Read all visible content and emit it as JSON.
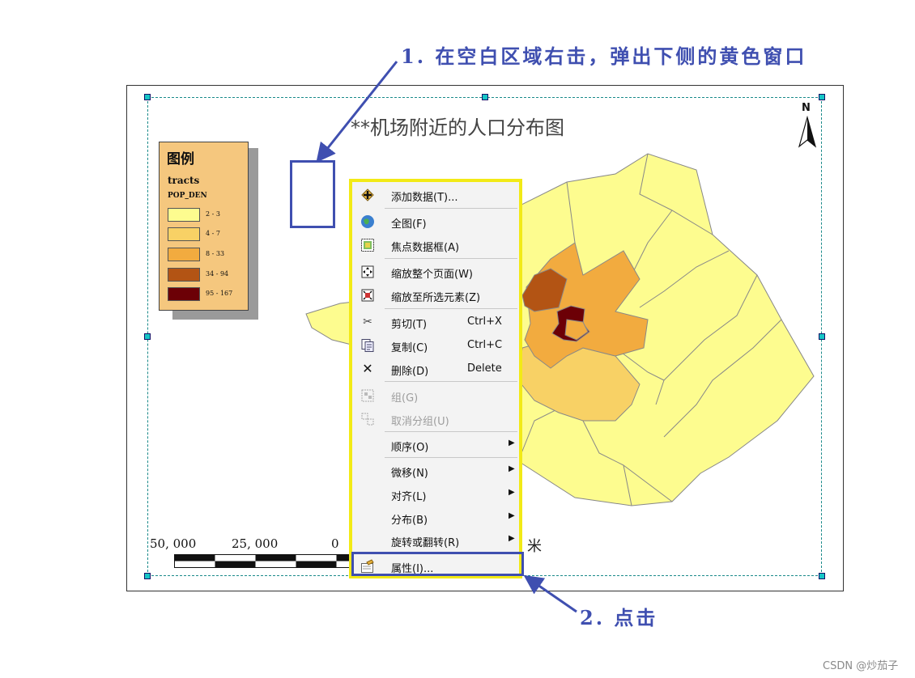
{
  "annotations": {
    "step1": "1. 在空白区域右击，弹出下侧的黄色窗口",
    "step2": "2. 点击"
  },
  "map": {
    "title": "**机场附近的人口分布图",
    "north_label": "N",
    "scale_labels": [
      "50, 000",
      "25, 000",
      "0"
    ],
    "scale_unit": "米"
  },
  "legend": {
    "title": "图例",
    "layer": "tracts",
    "field": "POP_DEN",
    "classes": [
      {
        "label": "2 - 3",
        "color": "#fdfc8f"
      },
      {
        "label": "4 - 7",
        "color": "#f8d165"
      },
      {
        "label": "8 - 33",
        "color": "#f2ab3f"
      },
      {
        "label": "34 - 94",
        "color": "#b35414"
      },
      {
        "label": "95 - 167",
        "color": "#6c0006"
      }
    ]
  },
  "context_menu": {
    "items": [
      {
        "id": "add-data",
        "label": "添加数据(T)...",
        "icon": "add-data-icon",
        "enabled": true
      },
      {
        "id": "full-extent",
        "label": "全图(F)",
        "icon": "globe-icon",
        "enabled": true
      },
      {
        "id": "focus-frame",
        "label": "焦点数据框(A)",
        "icon": "focus-frame-icon",
        "enabled": true
      },
      {
        "id": "zoom-page",
        "label": "缩放整个页面(W)",
        "icon": "zoom-page-icon",
        "enabled": true
      },
      {
        "id": "zoom-selected",
        "label": "缩放至所选元素(Z)",
        "icon": "zoom-selected-icon",
        "enabled": true
      },
      {
        "id": "cut",
        "label": "剪切(T)",
        "shortcut": "Ctrl+X",
        "icon": "scissors-icon",
        "enabled": true
      },
      {
        "id": "copy",
        "label": "复制(C)",
        "shortcut": "Ctrl+C",
        "icon": "copy-icon",
        "enabled": true
      },
      {
        "id": "delete",
        "label": "删除(D)",
        "shortcut": "Delete",
        "icon": "delete-icon",
        "enabled": true
      },
      {
        "id": "group",
        "label": "组(G)",
        "icon": "group-icon",
        "enabled": false
      },
      {
        "id": "ungroup",
        "label": "取消分组(U)",
        "icon": "ungroup-icon",
        "enabled": false
      },
      {
        "id": "order",
        "label": "顺序(O)",
        "submenu": true,
        "enabled": true
      },
      {
        "id": "nudge",
        "label": "微移(N)",
        "submenu": true,
        "enabled": true
      },
      {
        "id": "align",
        "label": "对齐(L)",
        "submenu": true,
        "enabled": true
      },
      {
        "id": "distribute",
        "label": "分布(B)",
        "submenu": true,
        "enabled": true
      },
      {
        "id": "rotate-flip",
        "label": "旋转或翻转(R)",
        "submenu": true,
        "enabled": true
      },
      {
        "id": "properties",
        "label": "属性(I)...",
        "icon": "properties-icon",
        "enabled": true
      }
    ]
  },
  "watermark": "CSDN @炒茄子",
  "colors": {
    "annotation_blue": "#3f4fb0",
    "menu_highlight_yellow": "#f2ea16",
    "frame_dash": "#1a8a8a"
  }
}
